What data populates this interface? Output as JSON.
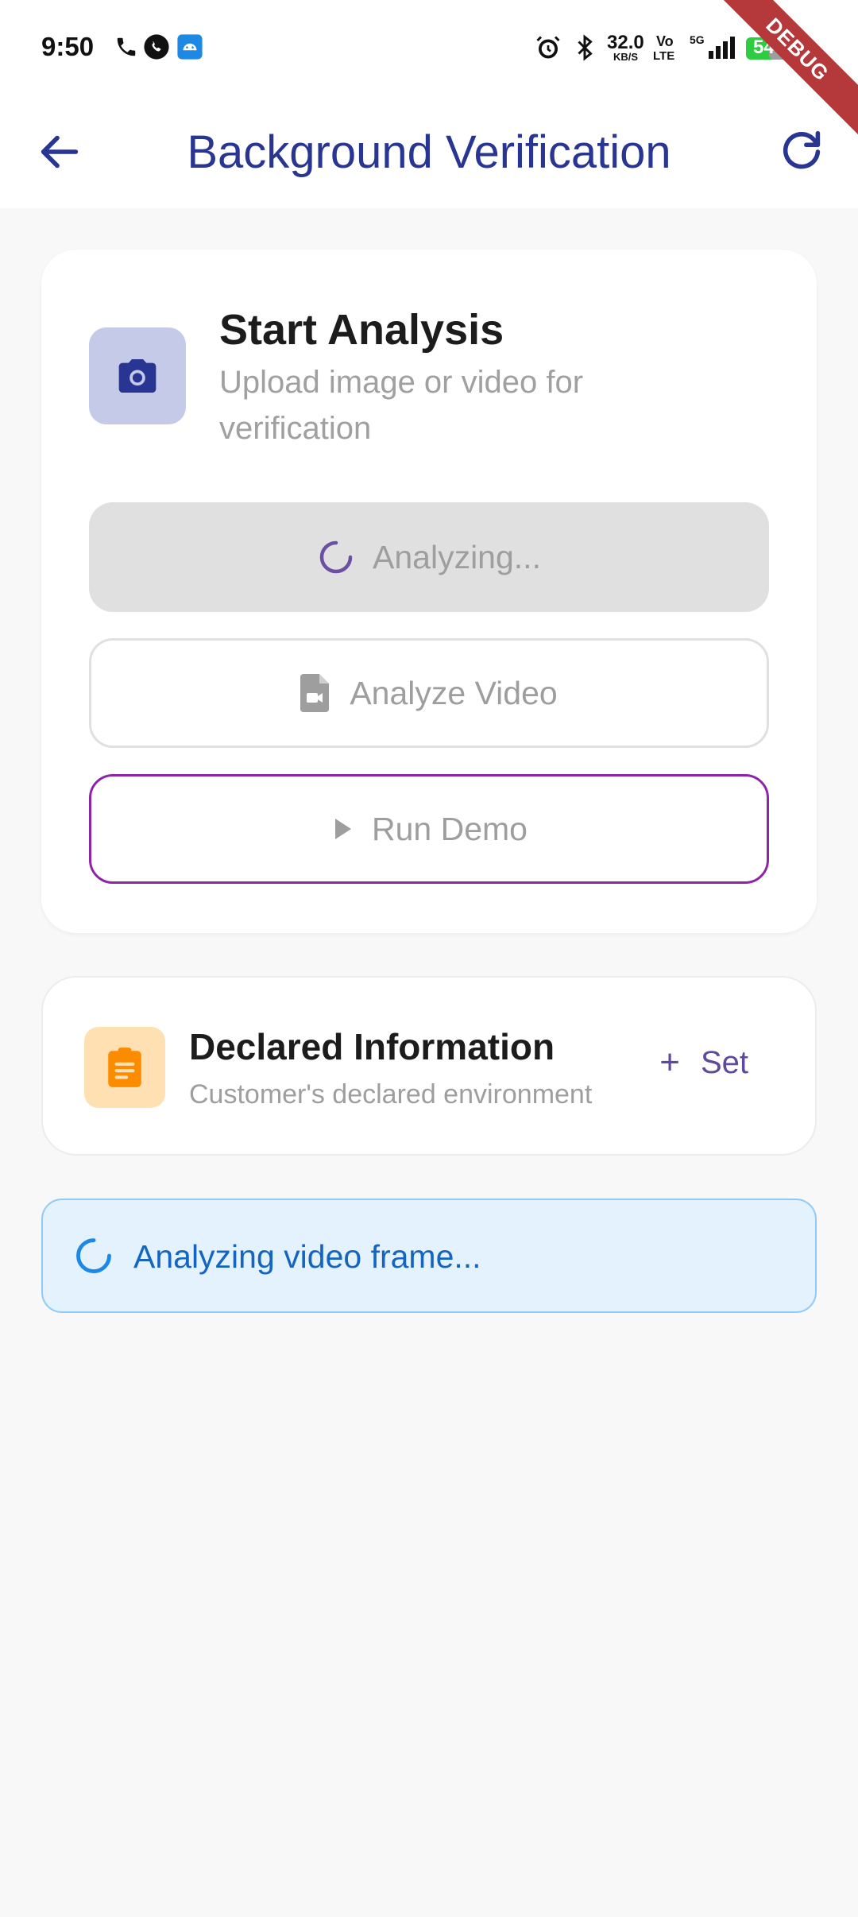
{
  "status_bar": {
    "time": "9:50",
    "network_speed": "32.0",
    "network_unit": "KB/S",
    "volte_top": "Vo",
    "volte_bottom": "LTE",
    "signal_label": "5G",
    "battery": "54"
  },
  "debug_banner": "DEBUG",
  "app_bar": {
    "title": "Background Verification",
    "back_icon": "arrow-left-icon",
    "refresh_icon": "refresh-icon"
  },
  "analysis_card": {
    "icon": "camera-icon",
    "title": "Start Analysis",
    "subtitle": "Upload image or video for verification",
    "buttons": {
      "analyzing_label": "Analyzing...",
      "video_label": "Analyze Video",
      "demo_label": "Run Demo"
    }
  },
  "declared_card": {
    "icon": "clipboard-icon",
    "title": "Declared Information",
    "subtitle": "Customer's declared environment",
    "set_label": "Set",
    "set_icon": "plus-icon"
  },
  "status_banner": {
    "text": "Analyzing video frame...",
    "icon": "spinner-icon"
  },
  "colors": {
    "title": "#283593",
    "camera_tile": "#c5cae9",
    "demo_border": "#8e24aa",
    "banner_bg": "#e3f2fd",
    "banner_text": "#1565c0",
    "clipboard_tile": "#ffe0b2"
  }
}
